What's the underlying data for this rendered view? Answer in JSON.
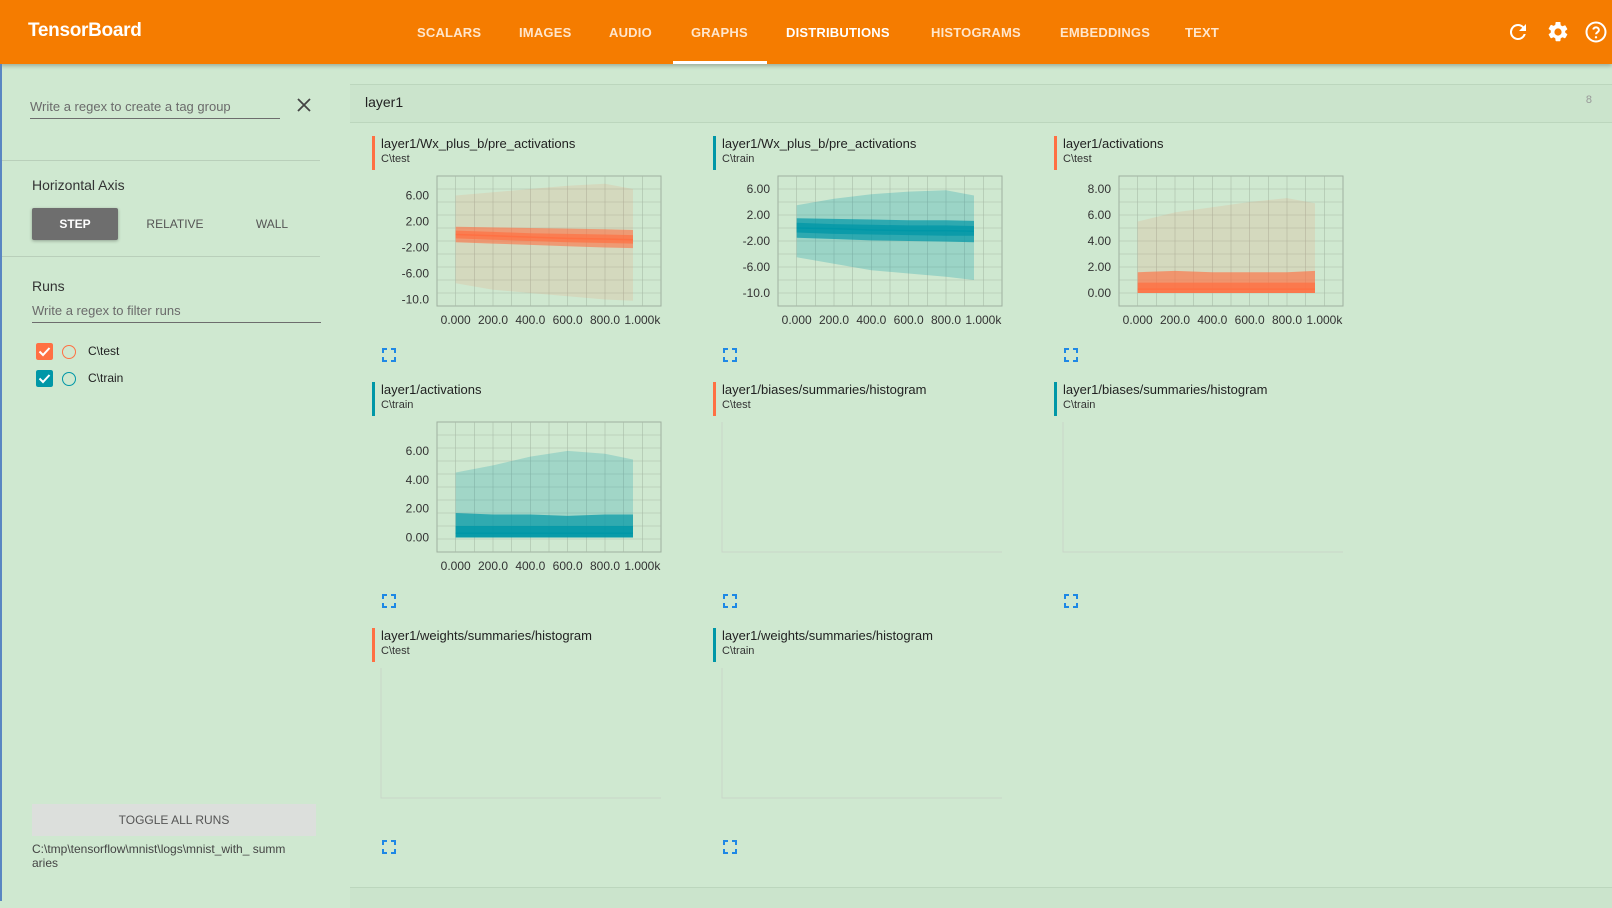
{
  "app": {
    "title": "TensorBoard"
  },
  "nav": {
    "tabs": [
      {
        "label": "SCALARS",
        "active": false
      },
      {
        "label": "IMAGES",
        "active": false
      },
      {
        "label": "AUDIO",
        "active": false
      },
      {
        "label": "GRAPHS",
        "active": false
      },
      {
        "label": "DISTRIBUTIONS",
        "active": true
      },
      {
        "label": "HISTOGRAMS",
        "active": false
      },
      {
        "label": "EMBEDDINGS",
        "active": false
      },
      {
        "label": "TEXT",
        "active": false
      }
    ],
    "icons": [
      "refresh-icon",
      "settings-icon",
      "help-icon"
    ]
  },
  "sidebar": {
    "tag_regex_placeholder": "Write a regex to create a tag group",
    "horizontal_axis_label": "Horizontal Axis",
    "axis_options": [
      {
        "label": "STEP",
        "selected": true
      },
      {
        "label": "RELATIVE",
        "selected": false
      },
      {
        "label": "WALL",
        "selected": false
      }
    ],
    "runs_label": "Runs",
    "runs_filter_placeholder": "Write a regex to filter runs",
    "runs": [
      {
        "name": "C\\test",
        "checked": true,
        "color": "#ff7043"
      },
      {
        "name": "C\\train",
        "checked": true,
        "color": "#0097a7"
      }
    ],
    "toggle_all_label": "TOGGLE ALL RUNS",
    "logdir": "C:\\tmp\\tensorflow\\mnist\\logs\\mnist_with_ summaries"
  },
  "group": {
    "title": "layer1",
    "count": "8"
  },
  "colors": {
    "test": "#ff7043",
    "train": "#0097a7",
    "accent": "#f57c00"
  },
  "cards": [
    {
      "title": "layer1/Wx_plus_b/pre_activations",
      "run": "C\\test",
      "color": "#ff7043",
      "has_chart": true
    },
    {
      "title": "layer1/Wx_plus_b/pre_activations",
      "run": "C\\train",
      "color": "#0097a7",
      "has_chart": true
    },
    {
      "title": "layer1/activations",
      "run": "C\\test",
      "color": "#ff7043",
      "has_chart": true
    },
    {
      "title": "layer1/activations",
      "run": "C\\train",
      "color": "#0097a7",
      "has_chart": true
    },
    {
      "title": "layer1/biases/summaries/histogram",
      "run": "C\\test",
      "color": "#ff7043",
      "has_chart": false
    },
    {
      "title": "layer1/biases/summaries/histogram",
      "run": "C\\train",
      "color": "#0097a7",
      "has_chart": false
    },
    {
      "title": "layer1/weights/summaries/histogram",
      "run": "C\\test",
      "color": "#ff7043",
      "has_chart": false
    },
    {
      "title": "layer1/weights/summaries/histogram",
      "run": "C\\train",
      "color": "#0097a7",
      "has_chart": false
    }
  ],
  "chart_data": [
    {
      "type": "area",
      "title": "layer1/Wx_plus_b/pre_activations",
      "run": "C\\test",
      "x_ticks": [
        "0.000",
        "200.0",
        "400.0",
        "600.0",
        "800.0",
        "1.000k"
      ],
      "y_ticks": [
        "6.00",
        "2.00",
        "-2.00",
        "-6.00",
        "-10.0"
      ],
      "xlim": [
        -100,
        1100
      ],
      "ylim": [
        -11,
        9
      ],
      "x": [
        0,
        200,
        400,
        600,
        800,
        950
      ],
      "bands": [
        {
          "lower": [
            -7.5,
            -8.5,
            -9,
            -9.5,
            -10,
            -10.2
          ],
          "upper": [
            6,
            6.5,
            7,
            7.5,
            7.8,
            7
          ],
          "opacity": 0.12
        },
        {
          "lower": [
            -1.2,
            -1.4,
            -1.6,
            -1.8,
            -2.0,
            -2.1
          ],
          "upper": [
            1.2,
            1.1,
            1.0,
            0.9,
            0.8,
            0.7
          ],
          "opacity": 0.6
        },
        {
          "lower": [
            -0.6,
            -0.8,
            -1.0,
            -1.2,
            -1.3,
            -1.4
          ],
          "upper": [
            0.6,
            0.4,
            0.2,
            0.1,
            0.0,
            -0.1
          ],
          "opacity": 0.7
        }
      ],
      "median": [
        0.0,
        -0.2,
        -0.4,
        -0.6,
        -0.7,
        -0.8
      ]
    },
    {
      "type": "area",
      "title": "layer1/Wx_plus_b/pre_activations",
      "run": "C\\train",
      "x_ticks": [
        "0.000",
        "200.0",
        "400.0",
        "600.0",
        "800.0",
        "1.000k"
      ],
      "y_ticks": [
        "6.00",
        "2.00",
        "-2.00",
        "-6.00",
        "-10.0"
      ],
      "xlim": [
        -100,
        1100
      ],
      "ylim": [
        -12,
        8
      ],
      "x": [
        0,
        200,
        400,
        600,
        800,
        950
      ],
      "bands": [
        {
          "lower": [
            -4.5,
            -5.5,
            -6.5,
            -7,
            -7.5,
            -8
          ],
          "upper": [
            3.5,
            4.5,
            5.2,
            5.6,
            5.8,
            5.0
          ],
          "opacity": 0.25
        },
        {
          "lower": [
            -1.5,
            -1.7,
            -1.9,
            -2.0,
            -2.1,
            -2.2
          ],
          "upper": [
            1.5,
            1.4,
            1.3,
            1.2,
            1.2,
            1.1
          ],
          "opacity": 0.7
        },
        {
          "lower": [
            -0.7,
            -0.9,
            -1.0,
            -1.1,
            -1.2,
            -1.2
          ],
          "upper": [
            0.8,
            0.6,
            0.5,
            0.4,
            0.4,
            0.3
          ],
          "opacity": 0.75
        }
      ],
      "median": [
        0.0,
        -0.1,
        -0.3,
        -0.4,
        -0.4,
        -0.5
      ]
    },
    {
      "type": "area",
      "title": "layer1/activations",
      "run": "C\\test",
      "x_ticks": [
        "0.000",
        "200.0",
        "400.0",
        "600.0",
        "800.0",
        "1.000k"
      ],
      "y_ticks": [
        "8.00",
        "6.00",
        "4.00",
        "2.00",
        "0.00"
      ],
      "xlim": [
        -100,
        1100
      ],
      "ylim": [
        -1,
        9
      ],
      "x": [
        0,
        200,
        400,
        600,
        800,
        950
      ],
      "bands": [
        {
          "lower": [
            0,
            0,
            0,
            0,
            0,
            0
          ],
          "upper": [
            5.5,
            6.2,
            6.6,
            7.0,
            7.3,
            6.9
          ],
          "opacity": 0.12
        },
        {
          "lower": [
            0,
            0,
            0,
            0,
            0,
            0
          ],
          "upper": [
            1.6,
            1.7,
            1.6,
            1.6,
            1.6,
            1.7
          ],
          "opacity": 0.65
        },
        {
          "lower": [
            0,
            0,
            0,
            0,
            0,
            0
          ],
          "upper": [
            0.8,
            0.8,
            0.8,
            0.8,
            0.8,
            0.8
          ],
          "opacity": 0.75
        }
      ],
      "median": [
        0.3,
        0.3,
        0.3,
        0.3,
        0.3,
        0.3
      ]
    },
    {
      "type": "area",
      "title": "layer1/activations",
      "run": "C\\train",
      "x_ticks": [
        "0.000",
        "200.0",
        "400.0",
        "600.0",
        "800.0",
        "1.000k"
      ],
      "y_ticks": [
        "6.00",
        "4.00",
        "2.00",
        "0.00"
      ],
      "xlim": [
        -100,
        1100
      ],
      "ylim": [
        -1,
        8
      ],
      "x": [
        0,
        200,
        400,
        600,
        800,
        950
      ],
      "bands": [
        {
          "lower": [
            0,
            0,
            0,
            0,
            0,
            0
          ],
          "upper": [
            4.5,
            5.0,
            5.6,
            6.0,
            5.8,
            5.4
          ],
          "opacity": 0.22
        },
        {
          "lower": [
            0,
            0,
            0,
            0,
            0,
            0
          ],
          "upper": [
            1.7,
            1.6,
            1.6,
            1.5,
            1.6,
            1.6
          ],
          "opacity": 0.7
        },
        {
          "lower": [
            0,
            0,
            0,
            0,
            0,
            0
          ],
          "upper": [
            0.8,
            0.8,
            0.8,
            0.8,
            0.8,
            0.8
          ],
          "opacity": 0.8
        }
      ],
      "median": [
        0.3,
        0.3,
        0.3,
        0.3,
        0.3,
        0.3
      ]
    }
  ]
}
